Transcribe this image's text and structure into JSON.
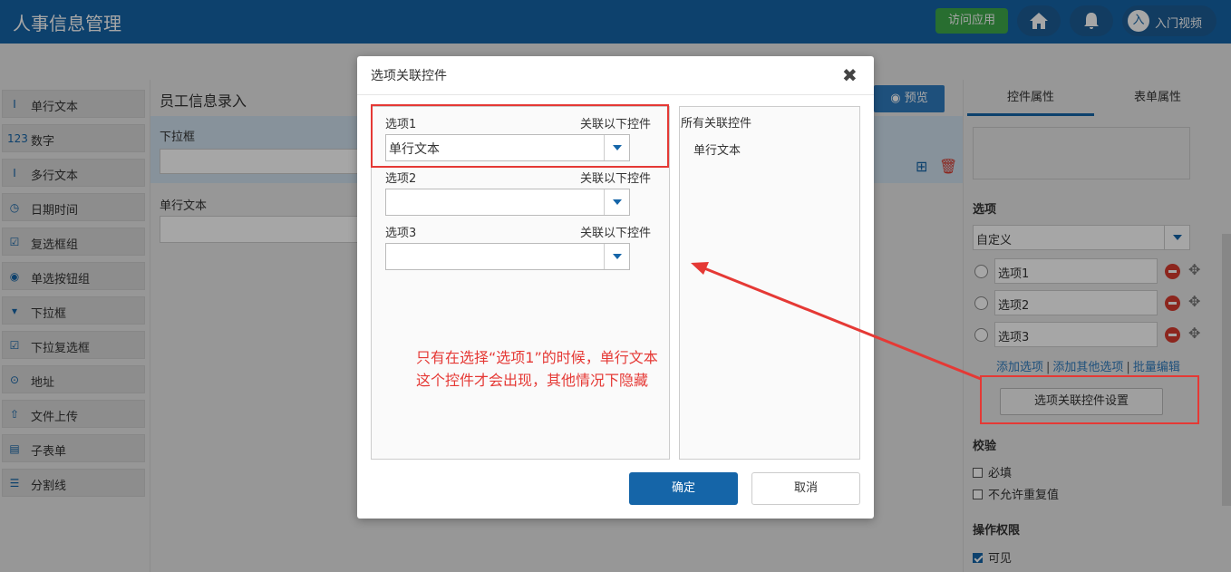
{
  "app": {
    "title": "人事信息管理",
    "visit_label": "访问应用",
    "video_label": "入门视频",
    "avatar_letter": "入"
  },
  "widgets": [
    "单行文本",
    "数字",
    "多行文本",
    "日期时间",
    "复选框组",
    "单选按钮组",
    "下拉框",
    "下拉复选框",
    "地址",
    "文件上传",
    "子表单",
    "分割线"
  ],
  "widget_icons": [
    "text-icon",
    "number-icon",
    "textarea-icon",
    "datetime-icon",
    "checkbox-group-icon",
    "radio-group-icon",
    "dropdown-icon",
    "dropdown-checkbox-icon",
    "location-icon",
    "upload-icon",
    "subform-icon",
    "divider-icon"
  ],
  "form": {
    "title": "员工信息录入",
    "preview_label": "预览",
    "fields": [
      {
        "label": "下拉框"
      },
      {
        "label": "单行文本"
      }
    ]
  },
  "right": {
    "tabs": [
      "控件属性",
      "表单属性"
    ],
    "options_section": "选项",
    "options_mode": "自定义",
    "options": [
      "选项1",
      "选项2",
      "选项3"
    ],
    "links": [
      "添加选项",
      "添加其他选项",
      "批量编辑"
    ],
    "assoc_button": "选项关联控件设置",
    "validate_section": "校验",
    "validate": [
      {
        "label": "必填",
        "checked": false
      },
      {
        "label": "不允许重复值",
        "checked": false
      }
    ],
    "perm_section": "操作权限",
    "perm": [
      {
        "label": "可见",
        "checked": true
      }
    ]
  },
  "modal": {
    "title": "选项关联控件",
    "close": "✖",
    "assoc_label": "关联以下控件",
    "options": [
      {
        "name": "选项1",
        "value": "单行文本"
      },
      {
        "name": "选项2",
        "value": ""
      },
      {
        "name": "选项3",
        "value": ""
      }
    ],
    "all_title": "所有关联控件",
    "all_items": [
      "单行文本"
    ],
    "note": "只有在选择“选项1”的时候，单行文本这个控件才会出现，其他情况下隐藏",
    "ok": "确定",
    "cancel": "取消"
  },
  "colors": {
    "header": "#1565a8",
    "accent": "#1565a8",
    "highlight": "#e53935",
    "visit": "#3ea94b"
  }
}
